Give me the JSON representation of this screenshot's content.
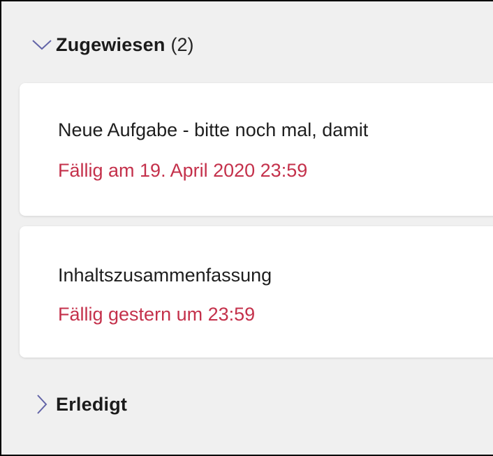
{
  "colors": {
    "background": "#f0f0f0",
    "card": "#ffffff",
    "due_red": "#c4314b",
    "chevron": "#6264a7",
    "text": "#1e1e1e"
  },
  "sections": {
    "assigned": {
      "title": "Zugewiesen",
      "count": "(2)",
      "icon": "chevron-down-icon",
      "expanded": true,
      "items": [
        {
          "title": "Neue Aufgabe - bitte noch mal, damit",
          "due": "Fällig am 19. April 2020 23:59"
        },
        {
          "title": "Inhaltszusammenfassung",
          "due": "Fällig gestern um 23:59"
        }
      ]
    },
    "done": {
      "title": "Erledigt",
      "icon": "chevron-right-icon",
      "expanded": false
    }
  }
}
